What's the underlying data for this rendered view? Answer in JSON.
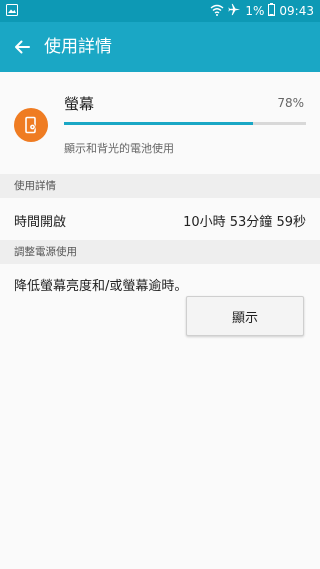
{
  "status_bar": {
    "battery_percent": "1%",
    "time": "09:43",
    "icons": [
      "gallery-icon",
      "wifi-icon",
      "airplane-icon",
      "battery-icon"
    ]
  },
  "app_bar": {
    "title": "使用詳情",
    "back_icon": "arrow-left-icon"
  },
  "usage_item": {
    "name": "螢幕",
    "percent_label": "78%",
    "percent_value": 78,
    "description": "顯示和背光的電池使用",
    "icon": "screen-settings-icon",
    "icon_color": "#ef7c22"
  },
  "usage_details": {
    "header": "使用詳情",
    "rows": [
      {
        "label": "時間開啟",
        "value": "10小時 53分鐘 59秒"
      }
    ]
  },
  "power_adjust": {
    "header": "調整電源使用",
    "text": "降低螢幕亮度和/或螢幕逾時。",
    "button_label": "顯示"
  },
  "colors": {
    "status_bar": "#0d99b5",
    "app_bar": "#1aa7c5",
    "accent": "#1aa7c5"
  }
}
